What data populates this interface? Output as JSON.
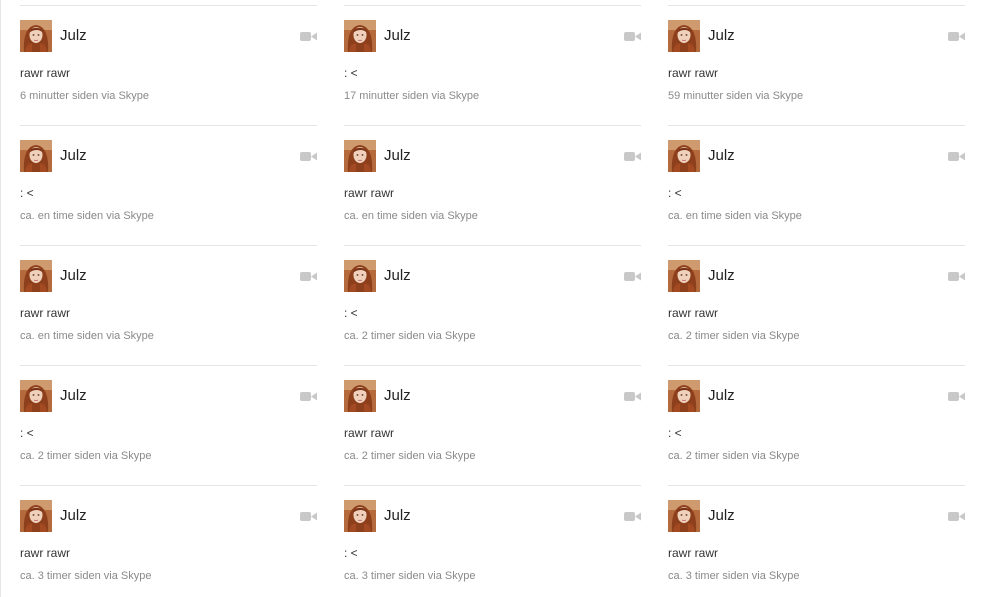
{
  "theme": {
    "name_color": "#222222",
    "message_color": "#333333",
    "meta_color": "#8a8a8a",
    "divider_color": "#e5e5e5",
    "icon_color": "#c8c8c8"
  },
  "icons": {
    "video": "video-camera-icon",
    "avatar": "user-photo"
  },
  "columns": [
    {
      "cards": [
        {
          "name": "Julz",
          "message": "rawr rawr",
          "time": "6 minutter siden",
          "via": "via",
          "service": "Skype"
        },
        {
          "name": "Julz",
          "message": ": <",
          "time": "ca. en time siden",
          "via": "via",
          "service": "Skype"
        },
        {
          "name": "Julz",
          "message": "rawr rawr",
          "time": "ca. en time siden",
          "via": "via",
          "service": "Skype"
        },
        {
          "name": "Julz",
          "message": ": <",
          "time": "ca. 2 timer siden",
          "via": "via",
          "service": "Skype"
        },
        {
          "name": "Julz",
          "message": "rawr rawr",
          "time": "ca. 3 timer siden",
          "via": "via",
          "service": "Skype"
        }
      ]
    },
    {
      "cards": [
        {
          "name": "Julz",
          "message": ": <",
          "time": "17 minutter siden",
          "via": "via",
          "service": "Skype"
        },
        {
          "name": "Julz",
          "message": "rawr rawr",
          "time": "ca. en time siden",
          "via": "via",
          "service": "Skype"
        },
        {
          "name": "Julz",
          "message": ": <",
          "time": "ca. 2 timer siden",
          "via": "via",
          "service": "Skype"
        },
        {
          "name": "Julz",
          "message": "rawr rawr",
          "time": "ca. 2 timer siden",
          "via": "via",
          "service": "Skype"
        },
        {
          "name": "Julz",
          "message": ": <",
          "time": "ca. 3 timer siden",
          "via": "via",
          "service": "Skype"
        }
      ]
    },
    {
      "cards": [
        {
          "name": "Julz",
          "message": "rawr rawr",
          "time": "59 minutter siden",
          "via": "via",
          "service": "Skype"
        },
        {
          "name": "Julz",
          "message": ": <",
          "time": "ca. en time siden",
          "via": "via",
          "service": "Skype"
        },
        {
          "name": "Julz",
          "message": "rawr rawr",
          "time": "ca. 2 timer siden",
          "via": "via",
          "service": "Skype"
        },
        {
          "name": "Julz",
          "message": ": <",
          "time": "ca. 2 timer siden",
          "via": "via",
          "service": "Skype"
        },
        {
          "name": "Julz",
          "message": "rawr rawr",
          "time": "ca. 3 timer siden",
          "via": "via",
          "service": "Skype"
        }
      ]
    }
  ]
}
